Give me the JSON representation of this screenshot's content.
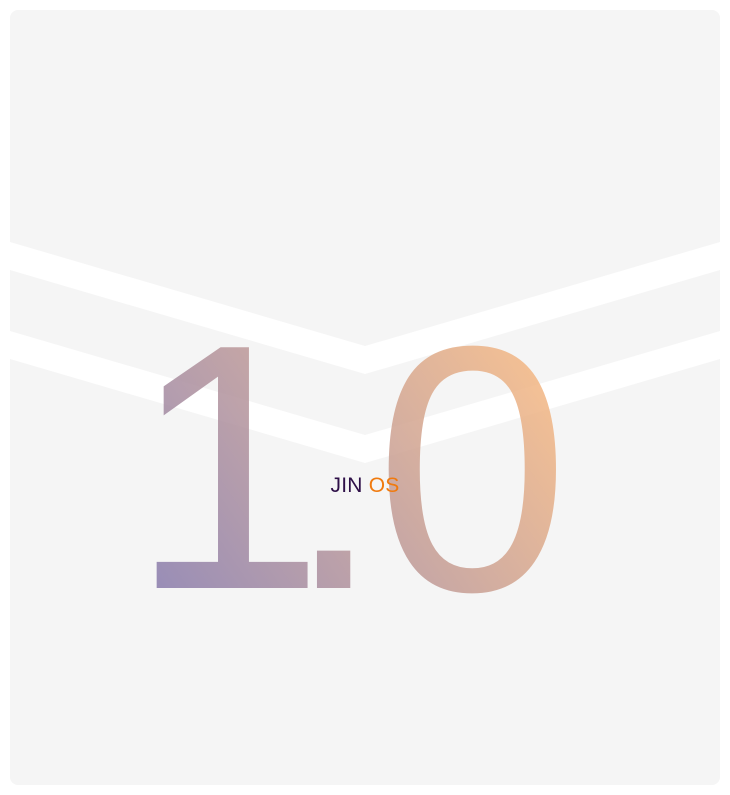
{
  "version": {
    "major": "1",
    "dot": ".",
    "minor": "0"
  },
  "brand": {
    "name_part1": "JIN",
    "name_part2": "OS"
  },
  "colors": {
    "background": "#f5f5f5",
    "chevrons": "#ffffff",
    "gradient_start": "#8a7cab",
    "gradient_end": "#ffbd7e",
    "brand_dark": "#2e1048",
    "brand_orange": "#f07a0e"
  }
}
